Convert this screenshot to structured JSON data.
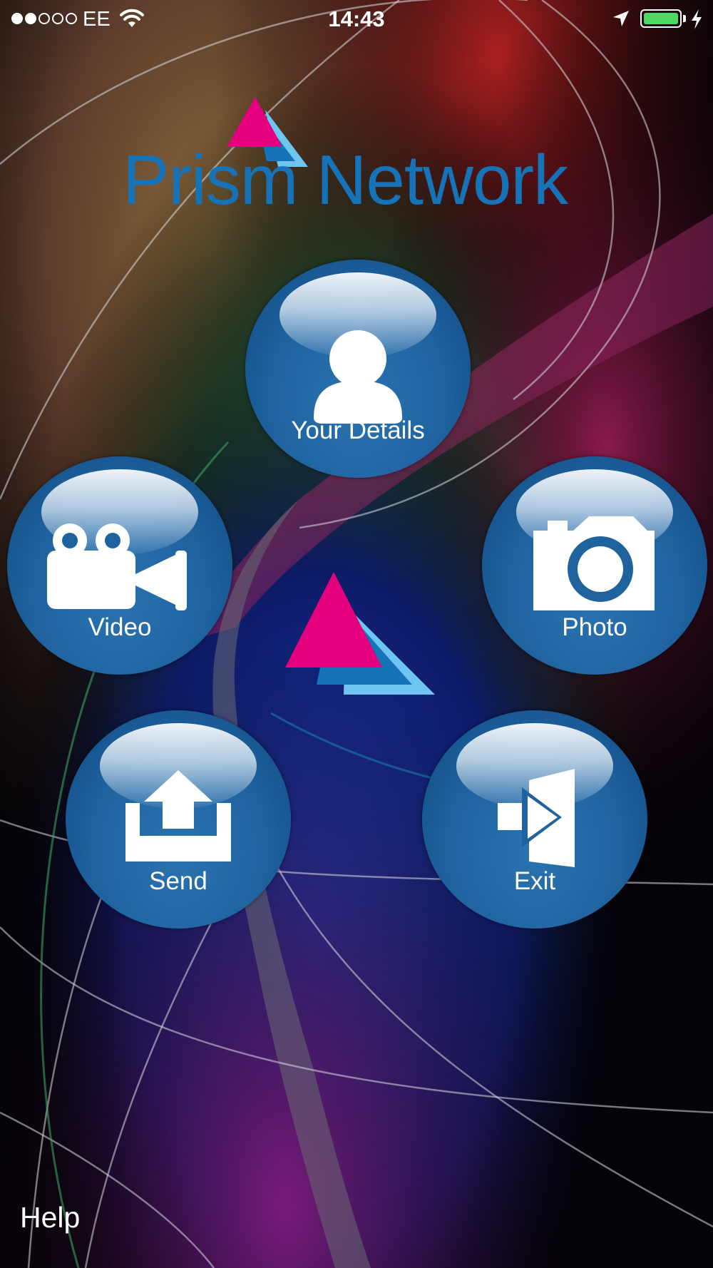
{
  "status_bar": {
    "signal_dots_filled": 2,
    "signal_dots_total": 5,
    "carrier": "EE",
    "time": "14:43",
    "battery_level": 1.0,
    "icons": [
      "wifi-icon",
      "location-arrow-icon",
      "battery-icon",
      "charging-bolt-icon"
    ]
  },
  "logo": {
    "text": "Prism Network"
  },
  "buttons": {
    "details": {
      "label": "Your Details",
      "icon": "person-icon"
    },
    "video": {
      "label": "Video",
      "icon": "video-camera-icon"
    },
    "photo": {
      "label": "Photo",
      "icon": "camera-icon"
    },
    "send": {
      "label": "Send",
      "icon": "upload-icon"
    },
    "exit": {
      "label": "Exit",
      "icon": "exit-door-icon"
    }
  },
  "help": {
    "label": "Help"
  },
  "colors": {
    "brand_blue": "#1673b8",
    "magenta": "#e4007f",
    "light_blue": "#6ec6f0",
    "button_blue": "#1e629e",
    "battery_green": "#4cd964"
  }
}
